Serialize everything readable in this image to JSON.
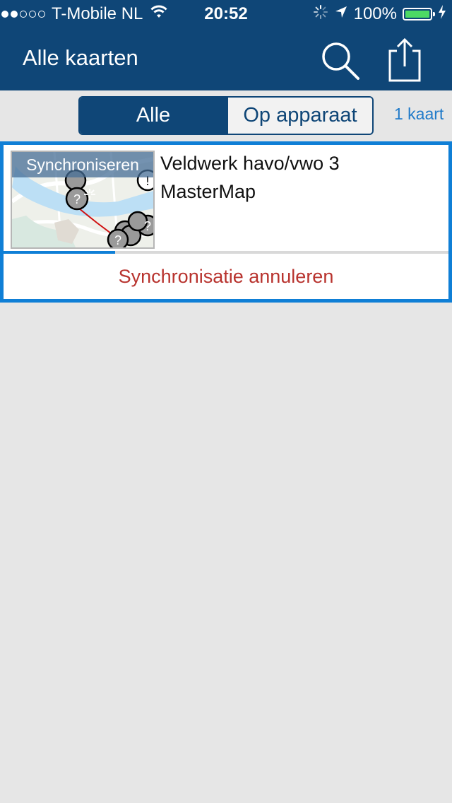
{
  "status_bar": {
    "carrier": "T-Mobile NL",
    "time": "20:52",
    "battery_percent": "100%",
    "signal_bars_full": 2,
    "signal_bars_total": 5,
    "icons": [
      "wifi-icon",
      "activity-spinner-icon",
      "location-arrow-icon",
      "battery-icon",
      "charging-bolt-icon"
    ]
  },
  "navbar": {
    "title": "Alle kaarten",
    "search_icon": "search-icon",
    "share_icon": "share-icon"
  },
  "filter": {
    "options": [
      "Alle",
      "Op apparaat"
    ],
    "selected": "Alle",
    "count_label": "1 kaart"
  },
  "maps": [
    {
      "title_line1": "Veldwerk havo/vwo 3",
      "title_line2": "MasterMap",
      "thumbnail_overlay": "Synchroniseren",
      "sync_progress": 0.25,
      "cancel_label": "Synchronisatie annuleren"
    }
  ],
  "colors": {
    "navbar": "#0f4677",
    "accent": "#0f7fd6",
    "cancel": "#b8332e",
    "background": "#e6e6e6"
  }
}
